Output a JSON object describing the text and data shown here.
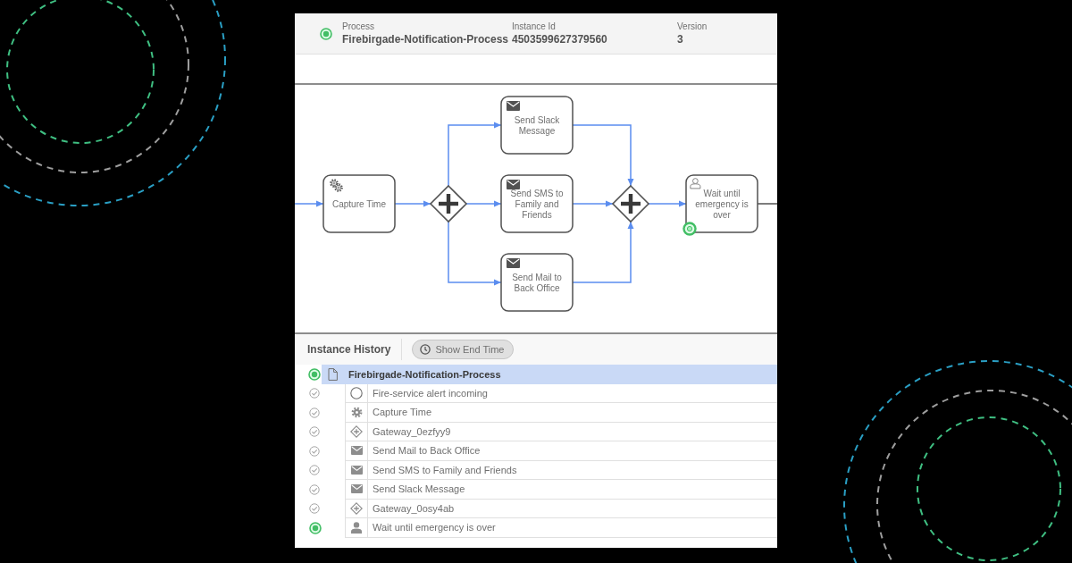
{
  "process_header": {
    "active": true,
    "fields": [
      {
        "label": "Process",
        "value": "Firebirgade-Notification-Process"
      },
      {
        "label": "Instance Id",
        "value": "4503599627379560"
      },
      {
        "label": "Version",
        "value": "3"
      }
    ]
  },
  "diagram": {
    "nodes": [
      {
        "kind": "service-task",
        "lines": [
          "Capture Time"
        ],
        "active": false
      },
      {
        "kind": "parallel-gateway",
        "active": false
      },
      {
        "kind": "send-task",
        "lines": [
          "Send Slack",
          "Message"
        ],
        "active": false
      },
      {
        "kind": "send-task",
        "lines": [
          "Send SMS to",
          "Family and",
          "Friends"
        ],
        "active": false
      },
      {
        "kind": "send-task",
        "lines": [
          "Send Mail to",
          "Back Office"
        ],
        "active": false
      },
      {
        "kind": "parallel-gateway",
        "active": false
      },
      {
        "kind": "user-task",
        "lines": [
          "Wait until",
          "emergency is",
          "over"
        ],
        "active": true
      }
    ]
  },
  "instance_history": {
    "title": "Instance History",
    "button": {
      "label": "Show End Time"
    },
    "tree": [
      {
        "kind": "process",
        "label": "Firebirgade-Notification-Process",
        "active": true,
        "selected": true,
        "children": [
          {
            "kind": "start-event",
            "label": "Fire-service alert incoming",
            "active": false,
            "selected": false
          },
          {
            "kind": "service-task",
            "label": "Capture Time",
            "active": false,
            "selected": false
          },
          {
            "kind": "parallel-gateway",
            "label": "Gateway_0ezfyy9",
            "active": false,
            "selected": false
          },
          {
            "kind": "send-task",
            "label": "Send Mail to Back Office",
            "active": false,
            "selected": false
          },
          {
            "kind": "send-task",
            "label": "Send SMS to Family and Friends",
            "active": false,
            "selected": false
          },
          {
            "kind": "send-task",
            "label": "Send Slack Message",
            "active": false,
            "selected": false
          },
          {
            "kind": "parallel-gateway",
            "label": "Gateway_0osy4ab",
            "active": false,
            "selected": false
          },
          {
            "kind": "user-task",
            "label": "Wait until emergency is over",
            "active": true,
            "selected": false
          }
        ]
      }
    ]
  }
}
